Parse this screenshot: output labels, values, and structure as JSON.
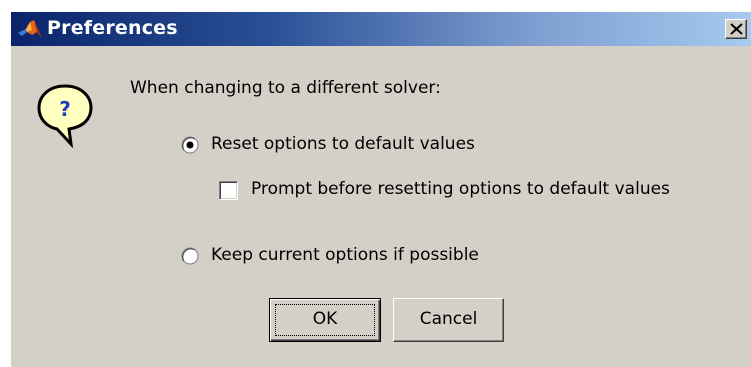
{
  "window": {
    "title": "Preferences",
    "title_icon": "matlab-logo-icon",
    "close_icon": "close-icon"
  },
  "dialog": {
    "icon": "question-balloon-icon",
    "icon_glyph": "?",
    "prompt": "When changing to a different solver:",
    "options": [
      {
        "label": "Reset options to default values",
        "selected": true
      },
      {
        "label": "Keep current options if possible",
        "selected": false
      }
    ],
    "checkbox": {
      "label": "Prompt before resetting options to default values",
      "checked": false
    }
  },
  "buttons": {
    "ok": "OK",
    "cancel": "Cancel"
  },
  "colors": {
    "title_gradient_start": "#0a246a",
    "title_gradient_end": "#a6caf0",
    "dialog_background": "#d4d0c8",
    "question_icon_fill": "#ffffc0"
  }
}
